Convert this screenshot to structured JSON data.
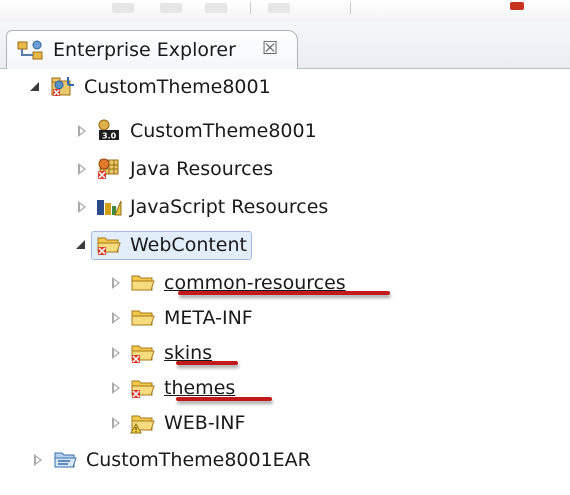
{
  "colors": {
    "annotation_red": "#c21a1a",
    "selection_bg": "#e3eefb",
    "folder_yellow": "#f2c94c"
  },
  "view": {
    "tab_title": "Enterprise Explorer",
    "tab_icon": "enterprise-explorer-icon",
    "close_glyph": "☒"
  },
  "tree": [
    {
      "label": "CustomTheme8001",
      "icon": "web-project-icon",
      "expanded": true
    },
    {
      "label": "CustomTheme8001",
      "icon": "facet-3.0-icon",
      "expanded": false
    },
    {
      "label": "Java Resources",
      "icon": "java-resources-icon",
      "expanded": false
    },
    {
      "label": "JavaScript Resources",
      "icon": "javascript-resources-icon",
      "expanded": false
    },
    {
      "label": "WebContent",
      "icon": "webcontent-folder-icon",
      "expanded": true,
      "selected": true
    },
    {
      "label": "common-resources",
      "icon": "folder-icon",
      "expanded": false,
      "annotated": true
    },
    {
      "label": "META-INF",
      "icon": "folder-icon",
      "expanded": false
    },
    {
      "label": "skins",
      "icon": "error-folder-icon",
      "expanded": false,
      "annotated": true
    },
    {
      "label": "themes",
      "icon": "error-folder-icon",
      "expanded": false,
      "annotated": true
    },
    {
      "label": "WEB-INF",
      "icon": "warning-folder-icon",
      "expanded": false
    },
    {
      "label": "CustomTheme8001EAR",
      "icon": "ear-project-icon",
      "expanded": false
    }
  ]
}
